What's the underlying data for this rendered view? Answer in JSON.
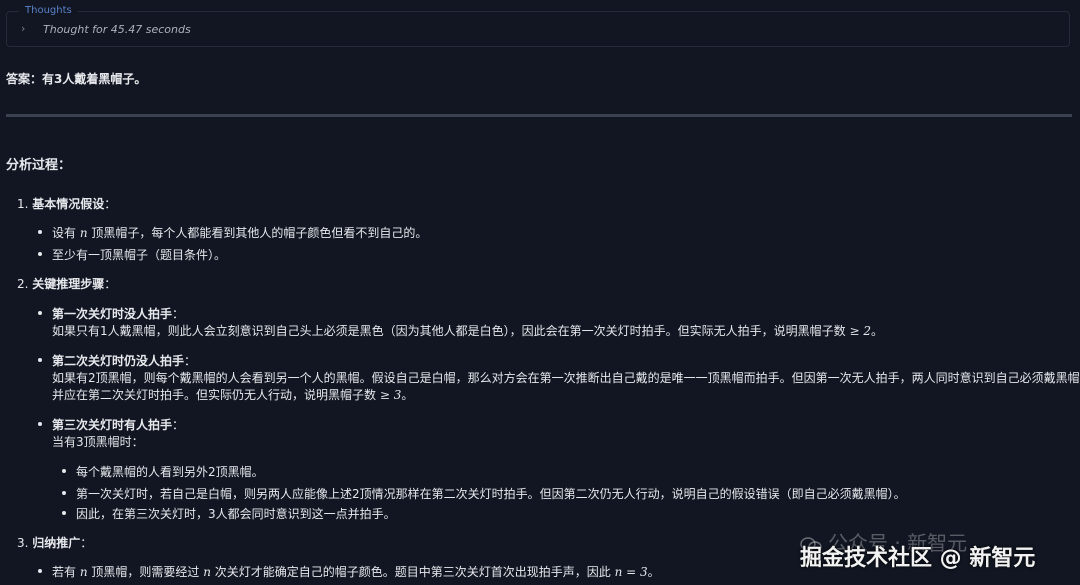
{
  "thoughts": {
    "legend": "Thoughts",
    "summary": "Thought for 45.47 seconds"
  },
  "answer": "答案：有3人戴着黑帽子。",
  "analysis_title": "分析过程：",
  "steps": [
    {
      "number": "1.",
      "title": "基本情况假设",
      "colon": "：",
      "bullets": [
        {
          "pre": "设有 ",
          "math": "n",
          "post": " 顶黑帽子，每个人都能看到其他人的帽子颜色但看不到自己的。"
        },
        {
          "text": "至少有一顶黑帽子（题目条件）。"
        }
      ]
    },
    {
      "number": "2.",
      "title": "关键推理步骤",
      "colon": "：",
      "bullets": [
        {
          "heading": "第一次关灯时没人拍手",
          "colon": "：",
          "line1_pre": "如果只有1人戴黑帽，则此人会立刻意识到自己头上必须是黑色（因为其他人都是白色），因此会在第一次关灯时拍手。但实际无人拍手，说明黑帽子数 ",
          "line1_math": "≥ 2",
          "line1_post": "。"
        },
        {
          "heading": "第二次关灯时仍没人拍手",
          "colon": "：",
          "line1": "如果有2顶黑帽，则每个戴黑帽的人会看到另一个人的黑帽。假设自己是白帽，那么对方会在第一次推断出自己戴的是唯一一顶黑帽而拍手。但因第一次无人拍手，两人同时意识到自己必须戴黑帽，",
          "line2_pre": "并应在第二次关灯时拍手。但实际仍无人行动，说明黑帽子数 ",
          "line2_math": "≥ 3",
          "line2_post": "。"
        },
        {
          "heading": "第三次关灯时有人拍手",
          "colon": "：",
          "intro": "当有3顶黑帽时：",
          "sub": [
            "每个戴黑帽的人看到另外2顶黑帽。",
            "第一次关灯时，若自己是白帽，则另两人应能像上述2顶情况那样在第二次关灯时拍手。但因第二次仍无人行动，说明自己的假设错误（即自己必须戴黑帽）。",
            "因此，在第三次关灯时，3人都会同时意识到这一点并拍手。"
          ]
        }
      ]
    },
    {
      "number": "3.",
      "title": "归纳推广",
      "colon": "：",
      "bullets": [
        {
          "pre": "若有 ",
          "math": "n",
          "mid": " 顶黑帽，则需要经过 ",
          "math2": "n",
          "post": " 次关灯才能确定自己的帽子颜色。题目中第三次关灯首次出现拍手声，因此 ",
          "math3": "n = 3",
          "post2": "。"
        }
      ]
    }
  ],
  "watermark": {
    "line1": "公众号 · 新智元",
    "line2": "掘金技术社区 @ 新智元"
  }
}
